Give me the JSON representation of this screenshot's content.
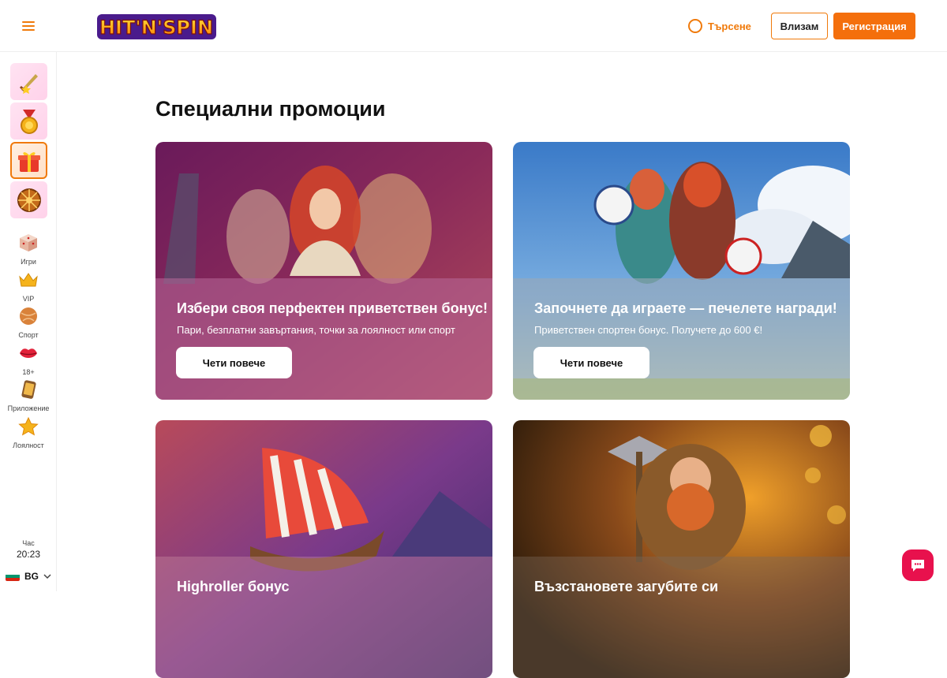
{
  "header": {
    "logo_text": "HIT'N'SPIN",
    "search_label": "Търсене",
    "login_label": "Влизам",
    "register_label": "Регистрация"
  },
  "sidebar": {
    "tiles": [
      {
        "icon": "sword-icon"
      },
      {
        "icon": "medal-icon"
      },
      {
        "icon": "gift-icon",
        "active": true
      },
      {
        "icon": "wheel-icon"
      }
    ],
    "items": [
      {
        "icon": "dice-icon",
        "label": "Игри"
      },
      {
        "icon": "crown-icon",
        "label": "VIP"
      },
      {
        "icon": "ball-icon",
        "label": "Спорт"
      },
      {
        "icon": "lips-icon",
        "label": "18+"
      },
      {
        "icon": "phone-icon",
        "label": "Приложение"
      },
      {
        "icon": "star-icon",
        "label": "Лоялност"
      }
    ],
    "clock_label": "Час",
    "clock_time": "20:23",
    "language": "BG"
  },
  "main": {
    "title": "Специални промоции",
    "cards": [
      {
        "title": "Избери своя перфектен приветствен бонус!",
        "description": "Пари, безплатни завъртания, точки за лоялност или спорт",
        "button": "Чети повече"
      },
      {
        "title": "Започнете да играете — печелете награди!",
        "description": "Приветствен спортен бонус. Получете до  600 €!",
        "button": "Чети повече"
      },
      {
        "title": "Highroller бонус",
        "description": "",
        "button": ""
      },
      {
        "title": "Възстановете загубите си",
        "description": "",
        "button": ""
      }
    ]
  },
  "colors": {
    "accent": "#f46f0c",
    "chat": "#e8114d"
  }
}
